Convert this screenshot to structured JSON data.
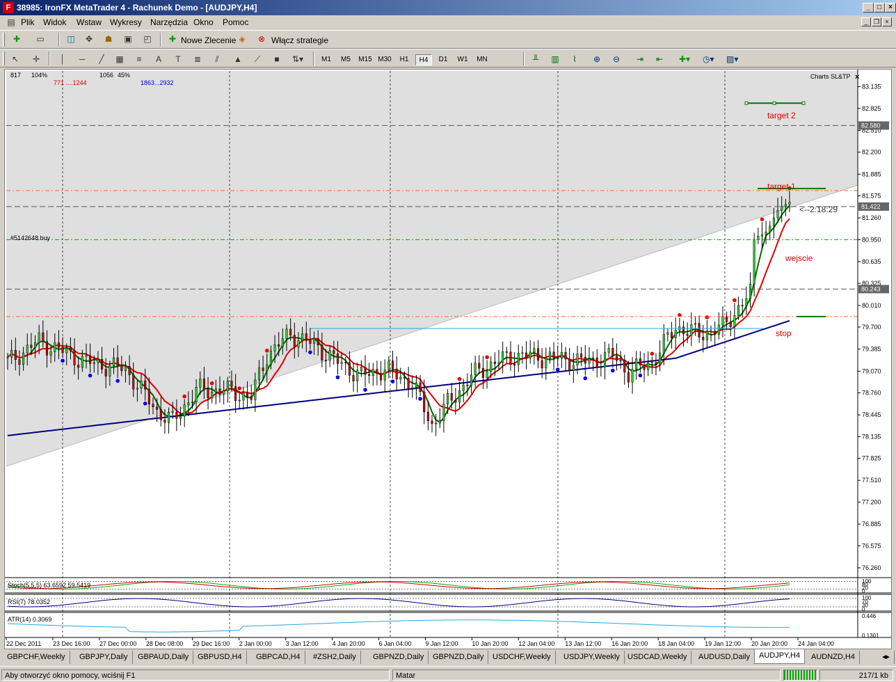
{
  "window": {
    "title": "38985: IronFX MetaTrader 4 - Rachunek Demo - [AUDJPY,H4]",
    "app_icon": "F"
  },
  "menu": [
    "Plik",
    "Widok",
    "Wstaw",
    "Wykresy",
    "Narzędzia",
    "Okno",
    "Pomoc"
  ],
  "toolbar1": {
    "new_order": "Nowe Zlecenie",
    "strategies": "Włącz strategie"
  },
  "timeframes": [
    "M1",
    "M5",
    "M15",
    "M30",
    "H1",
    "H4",
    "D1",
    "W1",
    "MN"
  ],
  "active_timeframe": "H4",
  "chart": {
    "info_line1": [
      "817",
      "104%",
      "1056",
      "45%"
    ],
    "info_line2_red": "771 ....1244",
    "info_line2_blue": "1863...2932",
    "indicator_name": "Charts SL&TP",
    "order_label": "#5142648 buy",
    "countdown": "<--2:18:29",
    "labels": {
      "target2": "target 2",
      "target1": "target 1",
      "entry": "wejscie",
      "stop": "stop"
    },
    "price_labels": [
      "83.135",
      "82.825",
      "82.510",
      "82.200",
      "81.885",
      "81.575",
      "81.260",
      "80.950",
      "80.635",
      "80.325",
      "80.010",
      "79.700",
      "79.385",
      "79.070",
      "78.760",
      "78.445",
      "78.135",
      "77.825",
      "77.510",
      "77.200",
      "76.885",
      "76.575",
      "76.260"
    ],
    "highlight_prices": [
      "82.580",
      "81.422",
      "80.243"
    ],
    "time_labels": [
      "22 Dec 2011",
      "23 Dec 16:00",
      "27 Dec 00:00",
      "28 Dec 08:00",
      "29 Dec 16:00",
      "2 Jan 00:00",
      "3 Jan 12:00",
      "4 Jan 20:00",
      "6 Jan 04:00",
      "9 Jan 12:00",
      "10 Jan 20:00",
      "12 Jan 04:00",
      "13 Jan 12:00",
      "16 Jan 20:00",
      "18 Jan 04:00",
      "19 Jan 12:00",
      "20 Jan 20:00",
      "24 Jan 04:00"
    ],
    "colors": {
      "up": "#33cc33",
      "down": "#cc0000",
      "ma_fast": "#006600",
      "ma_mid": "#dd0000",
      "ma_slow": "#000080"
    }
  },
  "subwindows": {
    "stoch": {
      "label": "Stoch(5,5,5) 63.6592 59.5419",
      "scale": [
        "100",
        "80",
        "20",
        "0"
      ]
    },
    "rsi": {
      "label": "RSI(7) 78.0352",
      "scale": [
        "100",
        "70",
        "30",
        "0"
      ]
    },
    "atr": {
      "label": "ATR(14) 0.3069",
      "scale": [
        "0.446",
        "0.1301"
      ]
    }
  },
  "tabs": [
    "GBPCHF,Weekly",
    "GBPJPY,Daily",
    "GBPAUD,Daily",
    "GBPUSD,H4",
    "GBPCAD,H4",
    "#ZSH2,Daily",
    "GBPNZD,Daily",
    "GBPNZD,Daily",
    "USDCHF,Weekly",
    "USDJPY,Weekly",
    "USDCAD,Weekly",
    "AUDUSD,Daily",
    "AUDJPY,H4",
    "AUDNZD,H4"
  ],
  "active_tab": "AUDJPY,H4",
  "status": {
    "help": "Aby otworzyć okno pomocy, wciśnij F1",
    "profile": "Matar",
    "traffic": "217/1 kb"
  }
}
